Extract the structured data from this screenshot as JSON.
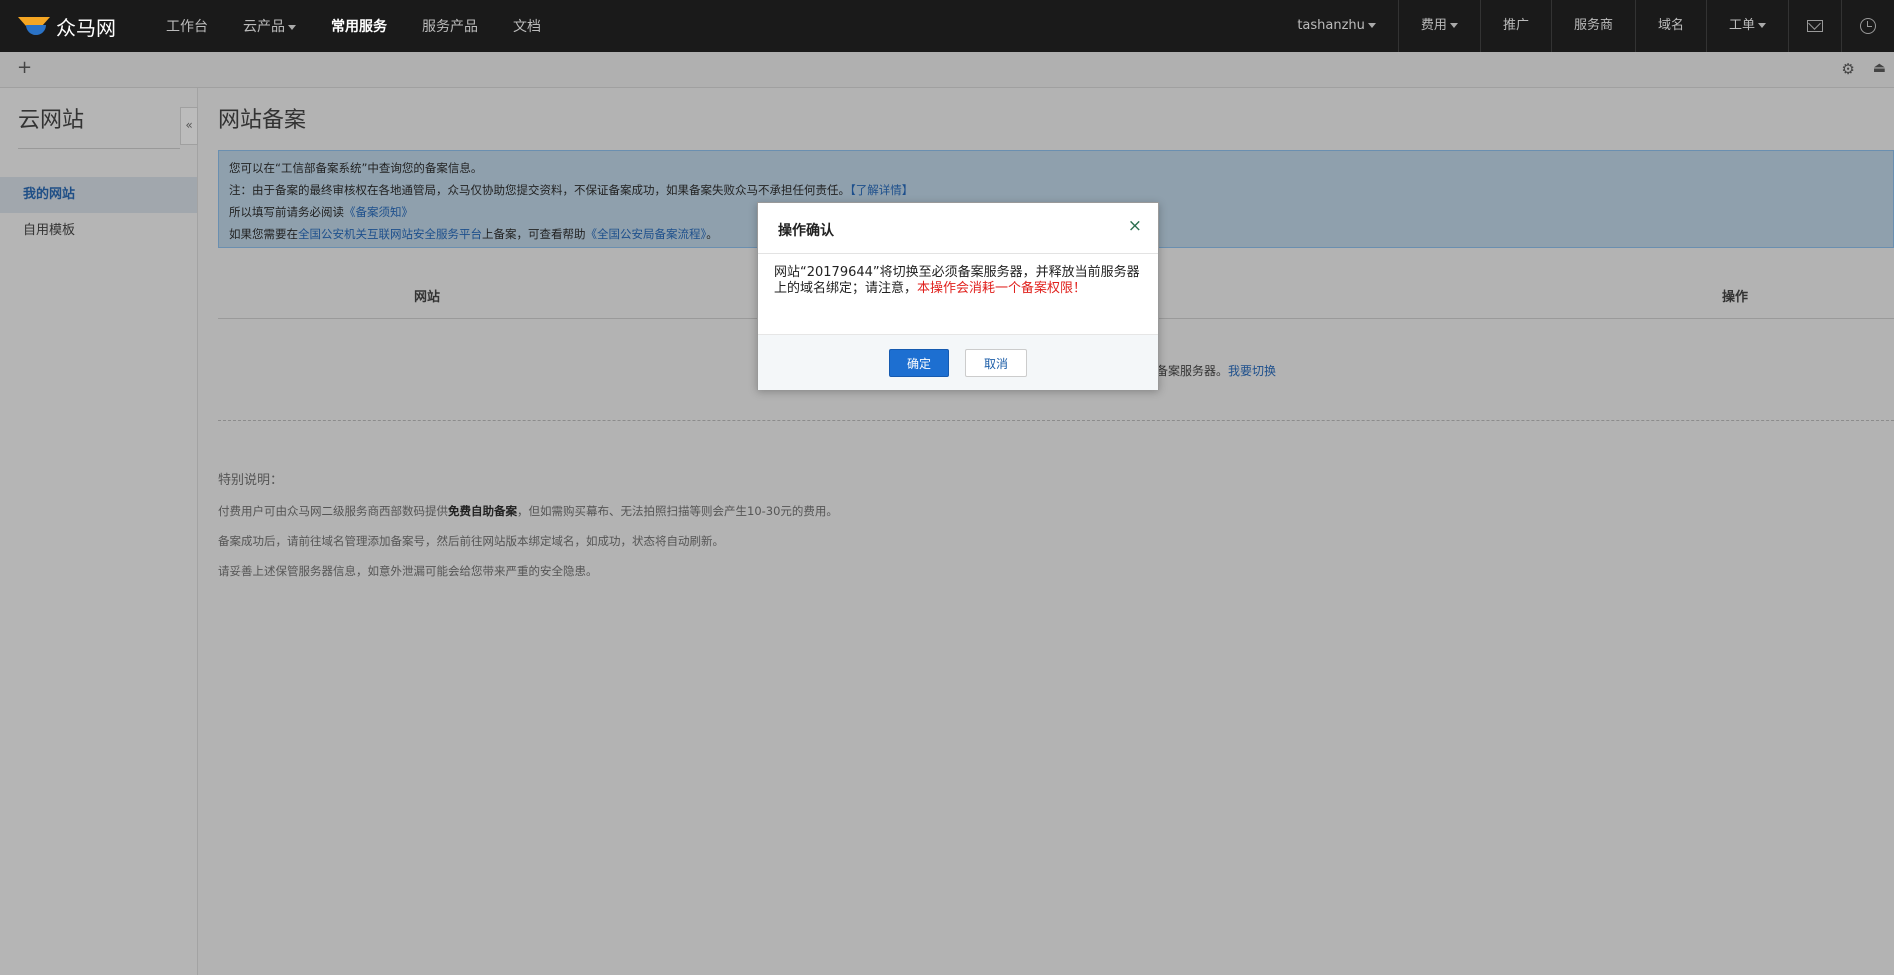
{
  "nav": {
    "logo_text": "众马网",
    "links": [
      "工作台",
      "云产品",
      "常用服务",
      "服务产品",
      "文档"
    ],
    "right": [
      "tashanzhu",
      "费用",
      "推广",
      "服务商",
      "域名",
      "工单"
    ]
  },
  "sidebar": {
    "title": "云网站",
    "items": [
      "我的网站",
      "自用模板"
    ]
  },
  "main": {
    "page_title": "网站备案",
    "notice": {
      "line1": "您可以在“工信部备案系统”中查询您的备案信息。",
      "line2": "注：由于备案的最终审核权在各地通管局，众马仅协助您提交资料，不保证备案成功，如果备案失败众马不承担任何责任。",
      "line2_link": "【了解详情】",
      "line3": "所以填写前请务必阅读",
      "line3_link": "《备案须知》",
      "line4a": "如果您需要在",
      "line4_link1": "全国公安机关互联网站安全服务平台",
      "line4b": "上备案，可查看帮助",
      "line4_link2": "《全国公安局备案流程》",
      "line4c": "。"
    },
    "table": {
      "col_site": "网站",
      "col_op": "操作",
      "row_text": "备案服务器。",
      "row_link": "我要切换"
    },
    "special": {
      "title": "特别说明：",
      "line1_a": "付费用户可由众马网二级服务商西部数码提供",
      "line1_b": "免费自助备案",
      "line1_c": "，但如需购买幕布、无法拍照扫描等则会产生10-30元的费用。",
      "line2": "备案成功后，请前往域名管理添加备案号，然后前往网站版本绑定域名，如成功，状态将自动刷新。",
      "line3": "请妥善上述保管服务器信息，如意外泄漏可能会给您带来严重的安全隐患。"
    }
  },
  "modal": {
    "title": "操作确认",
    "close": "×",
    "body_normal": "网站“20179644”将切换至必须备案服务器，并释放当前服务器上的域名绑定；请注意，",
    "body_warn": "本操作会消耗一个备案权限！",
    "ok": "确定",
    "cancel": "取消"
  },
  "colors": {
    "accent": "#1d6fd1",
    "warning": "#e0211d",
    "link": "#1d4f8c"
  }
}
